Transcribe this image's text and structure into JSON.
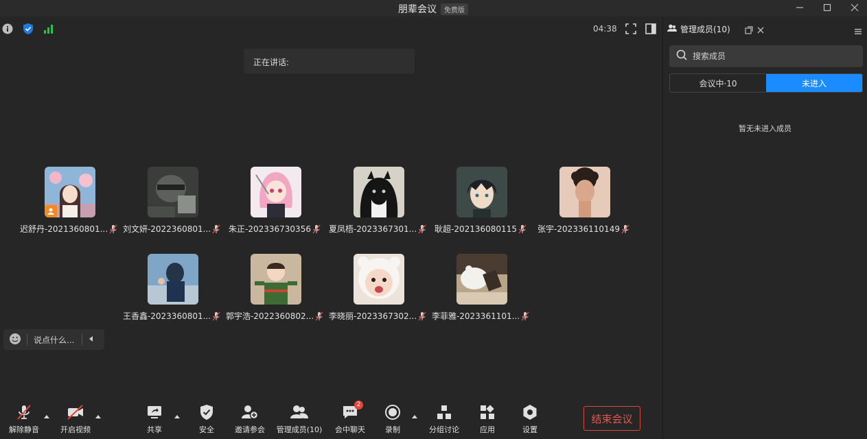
{
  "window": {
    "title": "朋辈会议",
    "edition": "免费版",
    "controls": [
      "minimize-icon",
      "maximize-icon",
      "close-icon"
    ]
  },
  "status": {
    "icons": [
      "info-icon",
      "shield-icon",
      "signal-icon"
    ],
    "timer": "04:38"
  },
  "speaking": {
    "label": "正在讲话:"
  },
  "participants": [
    {
      "name": "迟舒丹-2021360801...",
      "host": true,
      "avatar_color": "#8fb6d8"
    },
    {
      "name": "刘文妍-2022360801...",
      "host": false,
      "avatar_color": "#3a3d3a"
    },
    {
      "name": "朱正-202336730356",
      "host": false,
      "avatar_color": "#f3eaf0"
    },
    {
      "name": "夏凤梧-2023367301...",
      "host": false,
      "avatar_color": "#d7d2c8"
    },
    {
      "name": "耿超-202136080115",
      "host": false,
      "avatar_color": "#3e4a47"
    },
    {
      "name": "张宇-202336110149",
      "host": false,
      "avatar_color": "#e6cbbb"
    },
    {
      "name": "王香鑫-2023360801...",
      "host": false,
      "avatar_color": "#7fa6c7"
    },
    {
      "name": "郭宇浩-2022360802...",
      "host": false,
      "avatar_color": "#c9b79f"
    },
    {
      "name": "李晓丽-2023367302...",
      "host": false,
      "avatar_color": "#ece3da"
    },
    {
      "name": "李菲雅-2023361101...",
      "host": false,
      "avatar_color": "#b9a58a"
    }
  ],
  "chat_input": {
    "placeholder": "说点什么..."
  },
  "toolbar": {
    "unmute": "解除静音",
    "start_video": "开启视频",
    "share": "共享",
    "security": "安全",
    "invite": "邀请参会",
    "members": "管理成员(10)",
    "chat": "会中聊天",
    "chat_badge": "2",
    "record": "录制",
    "breakout": "分组讨论",
    "apps": "应用",
    "settings": "设置",
    "end_meeting": "结束会议"
  },
  "panel": {
    "title": "管理成员(10)",
    "search_placeholder": "搜索成员",
    "tab_in_meeting": "会议中·10",
    "tab_not_joined": "未进入",
    "empty_text": "暂无未进入成员"
  },
  "colors": {
    "accent": "#1a8cff",
    "danger": "#e5453a",
    "background": "#262626"
  }
}
